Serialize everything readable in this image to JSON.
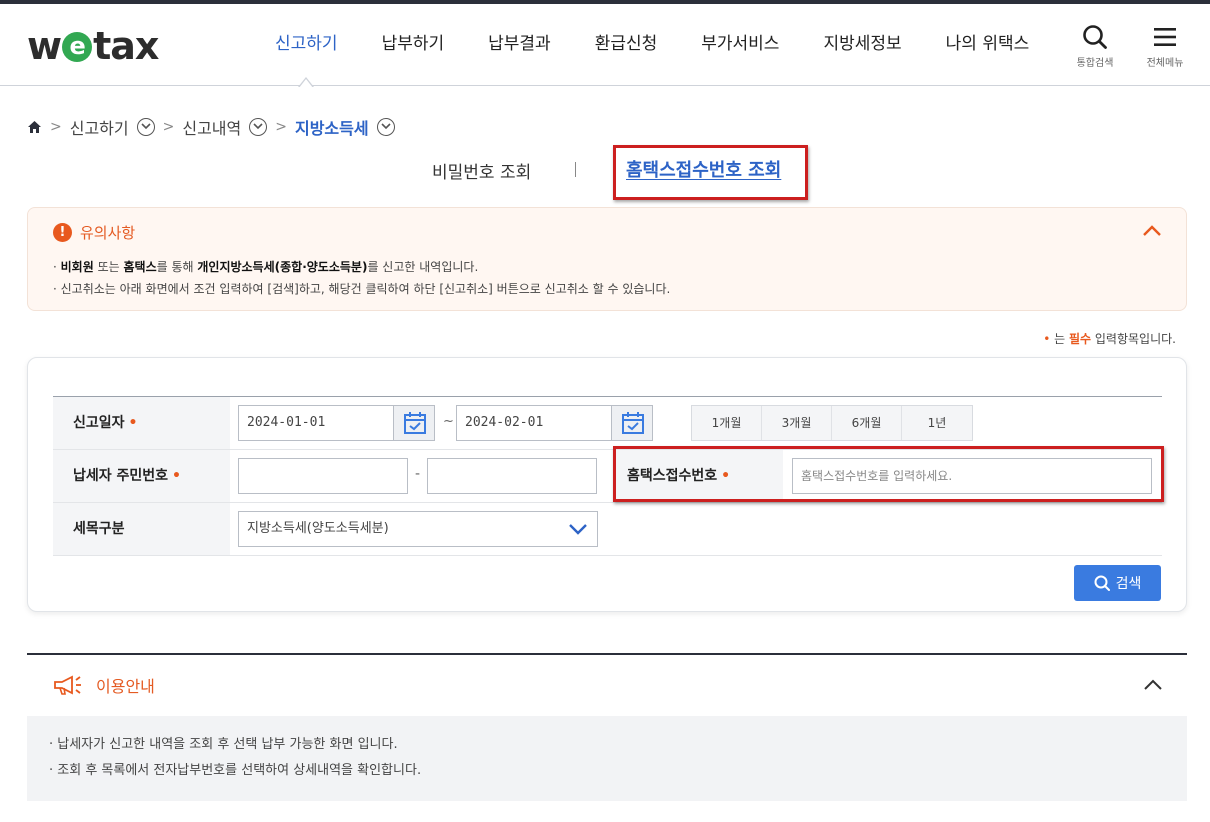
{
  "header": {
    "logo_prefix": "w",
    "logo_e": "e",
    "logo_suffix": "tax",
    "menus": [
      "신고하기",
      "납부하기",
      "납부결과",
      "환급신청",
      "부가서비스",
      "지방세정보",
      "나의 위택스"
    ],
    "active_menu": "신고하기",
    "search_label": "통합검색",
    "allmenu_label": "전체메뉴"
  },
  "breadcrumb": {
    "items": [
      "신고하기",
      "신고내역",
      "지방소득세"
    ],
    "home_icon": "home-icon"
  },
  "subtabs": {
    "tab1": "비밀번호 조회",
    "tab2": "홈택스접수번호 조회",
    "active": "홈택스접수번호 조회"
  },
  "notice": {
    "title": "유의사항",
    "line1_bullet": "· ",
    "line1_a": "비회원",
    "line1_b": " 또는 ",
    "line1_c": "홈택스",
    "line1_d": "를 통해 ",
    "line1_e": "개인지방소득세(종합·양도소득분)",
    "line1_f": "를 신고한 내역입니다.",
    "line2": "· 신고취소는 아래 화면에서 조건 입력하여 [검색]하고, 해당건 클릭하여 하단 [신고취소] 버튼으로 신고취소 할 수 있습니다."
  },
  "required_note": {
    "dot": "•",
    "pre": " 는 ",
    "word": "필수",
    "post": " 입력항목입니다."
  },
  "form": {
    "date_label": "신고일자",
    "date_from": "2024-01-01",
    "date_tilde": "~",
    "date_to": "2024-02-01",
    "periods": [
      "1개월",
      "3개월",
      "6개월",
      "1년"
    ],
    "rrn_label": "납세자 주민번호",
    "rrn_dash": "-",
    "rrn_front": "",
    "rrn_back": "",
    "hometax_label": "홈택스접수번호",
    "hometax_placeholder": "홈택스접수번호를 입력하세요.",
    "tax_label": "세목구분",
    "tax_selected": "지방소득세(양도소득세분)",
    "required_mark": "•",
    "search_button": "검색"
  },
  "guide": {
    "title": "이용안내",
    "lines": [
      "· 납세자가 신고한 내역을 조회 후 선택 납부 가능한 화면 입니다.",
      "· 조회 후 목록에서 전자납부번호를 선택하여 상세내역을 확인합니다."
    ]
  },
  "colors": {
    "accent_blue": "#2d63c6",
    "accent_orange": "#e8591e",
    "highlight_red": "#cc1f1f",
    "button_blue": "#3a7be0"
  }
}
